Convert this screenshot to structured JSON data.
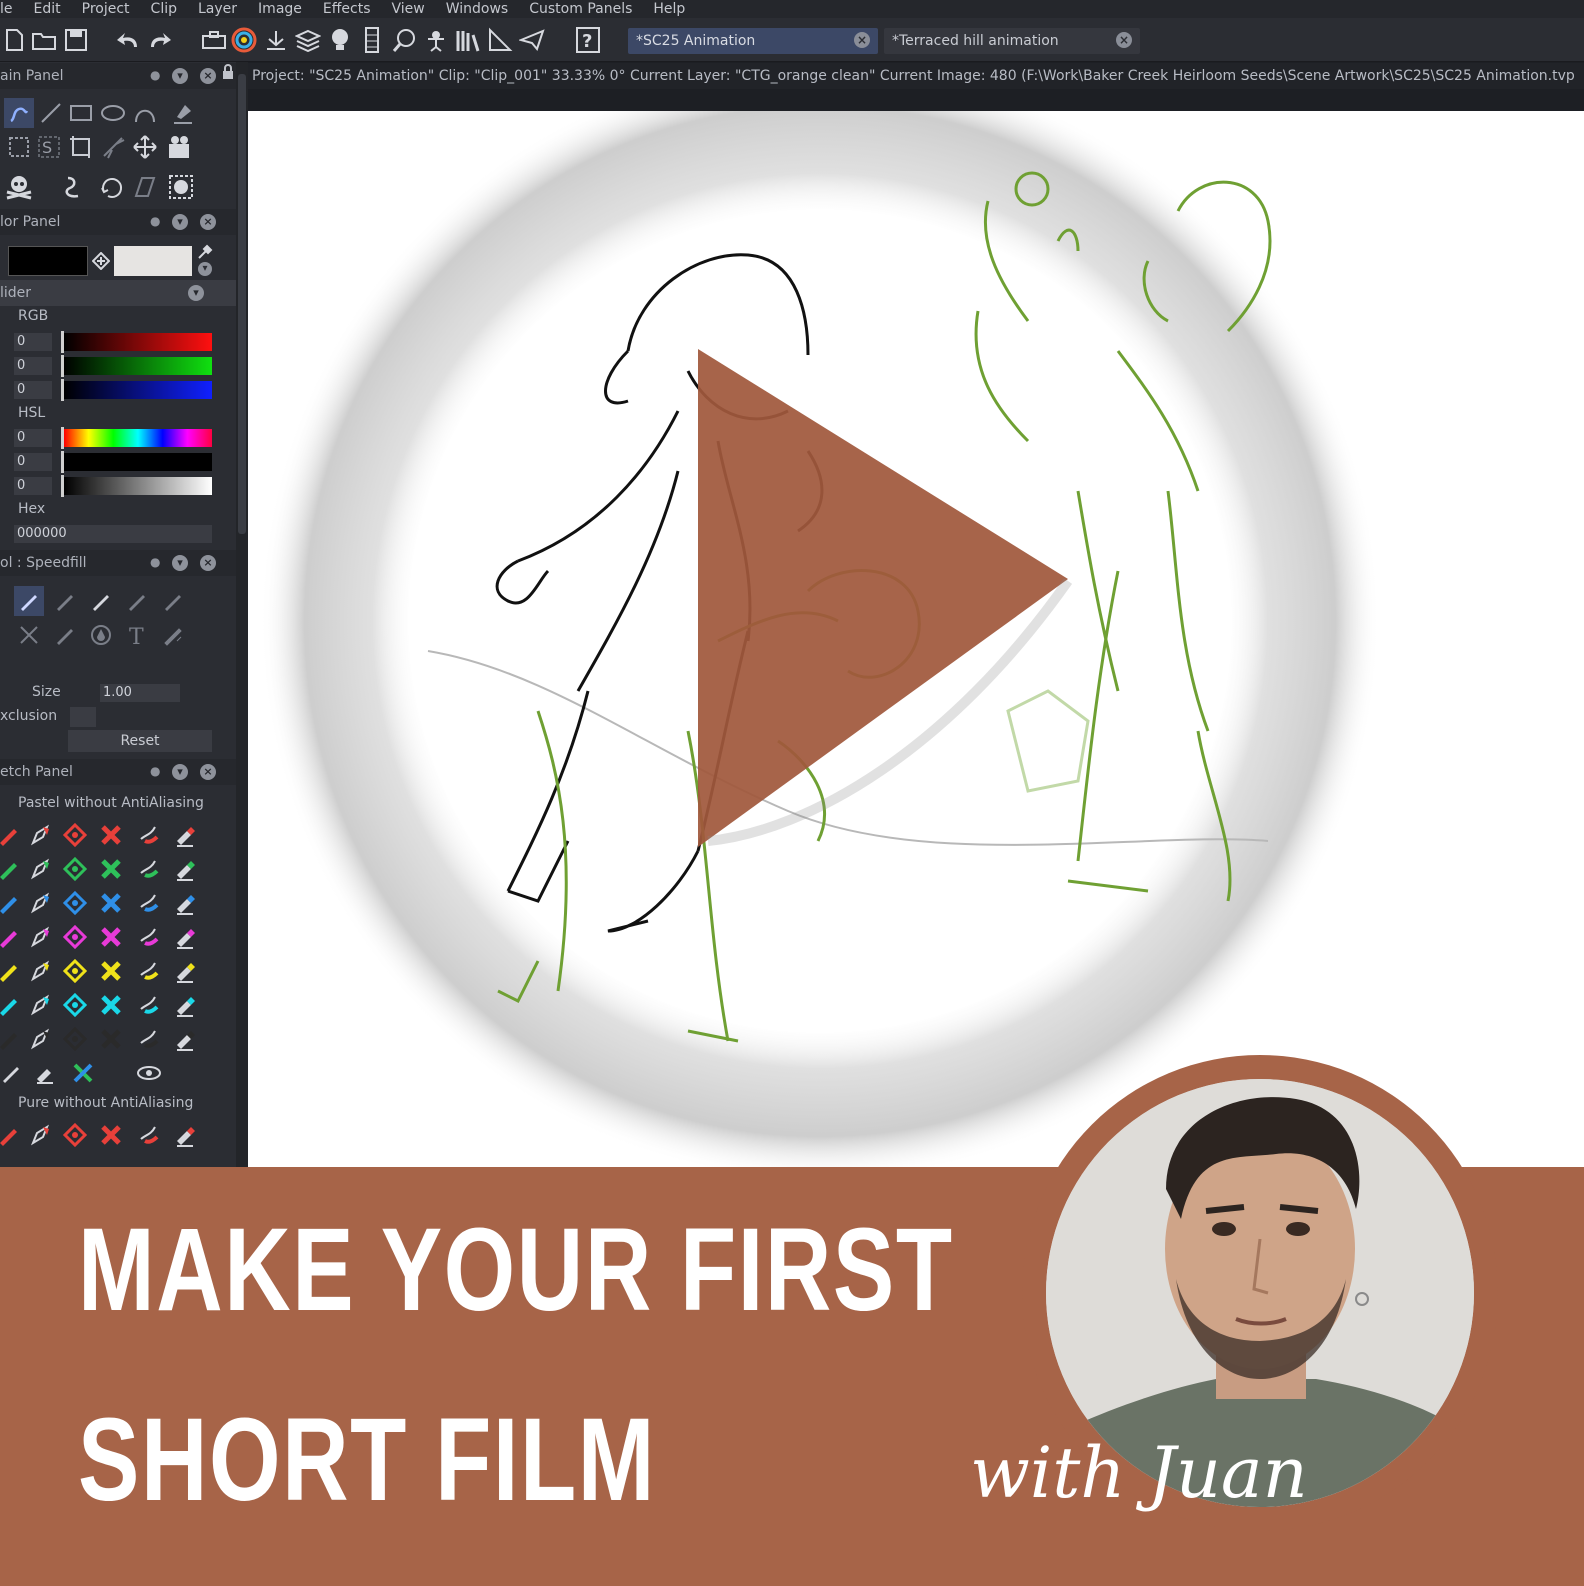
{
  "menu": {
    "items": [
      "le",
      "Edit",
      "Project",
      "Clip",
      "Layer",
      "Image",
      "Effects",
      "View",
      "Windows",
      "Custom Panels",
      "Help"
    ]
  },
  "toolbar": {
    "tabs": [
      {
        "label": "*SC25 Animation",
        "active": true
      },
      {
        "label": "*Terraced hill animation",
        "active": false
      }
    ]
  },
  "status": {
    "text": "Project: \"SC25 Animation\"  Clip: \"Clip_001\"   33.33%   0°  Current Layer: \"CTG_orange clean\"  Current Image: 480 (F:\\Work\\Baker Creek Heirloom Seeds\\Scene Artwork\\SC25\\SC25 Animation.tvp"
  },
  "panels": {
    "main": {
      "title": "ain Panel"
    },
    "color": {
      "title": "lor Panel",
      "primary_color": "#000000",
      "secondary_color": "#e6e4e2"
    },
    "slider": {
      "title": "lider"
    },
    "rgb": {
      "label": "RGB",
      "values": [
        "0",
        "0",
        "0"
      ]
    },
    "hsl": {
      "label": "HSL",
      "values": [
        "0",
        "0",
        "0"
      ]
    },
    "hex": {
      "label": "Hex",
      "value": "000000"
    },
    "tool": {
      "title": "ol : Speedfill",
      "size_label": "Size",
      "size_value": "1.00",
      "exclusion_label": "xclusion",
      "reset_label": "Reset"
    },
    "sketch": {
      "title": "etch Panel",
      "group1": "Pastel without AntiAliasing",
      "group2": "Pure without AntiAliasing",
      "row_colors": [
        "#e8403a",
        "#2ec05a",
        "#2f8fe8",
        "#e83ad8",
        "#f0e21a",
        "#1ad8e8",
        "#2a2a2a"
      ]
    }
  },
  "banner": {
    "title_line1": "Make Your First",
    "title_line2": "Short Film",
    "with_name": "with Juan"
  },
  "colors": {
    "accent_brown": "#a76448",
    "sketch_green": "#6fa033",
    "play_triangle": "#a0583c"
  }
}
